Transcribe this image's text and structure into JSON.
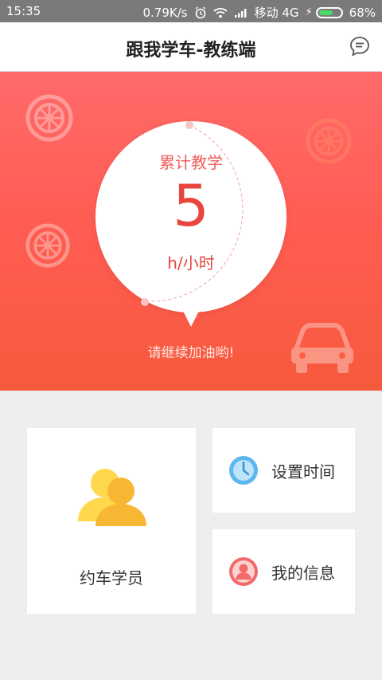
{
  "status_bar": {
    "time": "15:35",
    "network_speed": "0.79K/s",
    "carrier": "移动 4G",
    "battery": "68%",
    "battery_level": 0.68,
    "icons": [
      "alarm-icon",
      "wifi-icon",
      "signal-icon",
      "charging-icon",
      "battery-icon"
    ]
  },
  "header": {
    "title": "跟我学车-教练端",
    "message_icon": "chat-bubble-icon"
  },
  "hero": {
    "label": "累计教学",
    "value": "5",
    "unit": "h/小时",
    "encourage": "请继续加油哟!",
    "decor_icons": [
      "wheel-icon",
      "car-icon"
    ]
  },
  "cards": {
    "students": {
      "label": "约车学员",
      "icon": "users-icon"
    },
    "time": {
      "label": "设置时间",
      "icon": "clock-icon"
    },
    "info": {
      "label": "我的信息",
      "icon": "user-avatar-icon"
    }
  },
  "colors": {
    "hero_top": "#ff6a6a",
    "hero_bottom": "#f65a3c",
    "accent": "#e8453d",
    "clock_blue": "#5bb7ee",
    "avatar_red": "#f26a6a",
    "users_yellow": "#ffd84d",
    "users_orange": "#f7b733"
  }
}
